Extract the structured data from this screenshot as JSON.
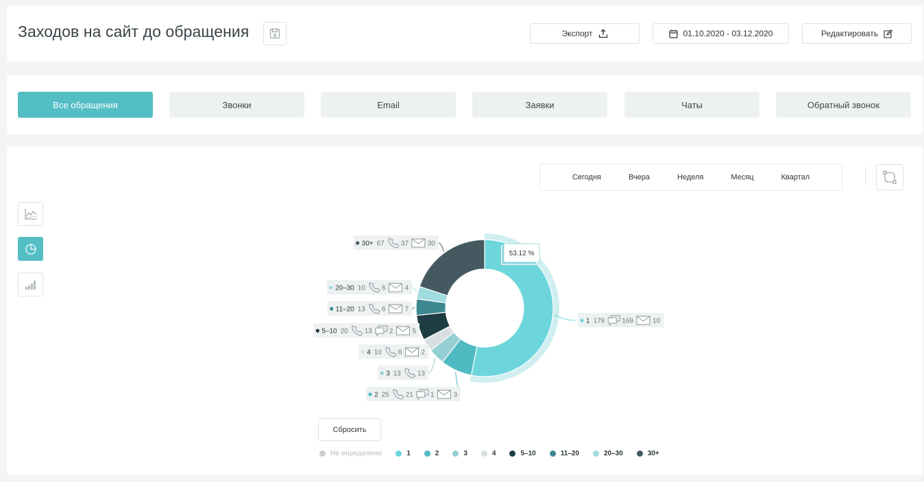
{
  "header": {
    "title": "Заходов на сайт до обращения",
    "export_label": "Экспорт",
    "date_range": "01.10.2020 - 03.12.2020",
    "edit_label": "Редактировать"
  },
  "tabs": [
    {
      "label": "Все обращения",
      "active": true
    },
    {
      "label": "Звонки",
      "active": false
    },
    {
      "label": "Email",
      "active": false
    },
    {
      "label": "Заявки",
      "active": false
    },
    {
      "label": "Чаты",
      "active": false
    },
    {
      "label": "Обратный звонок",
      "active": false
    }
  ],
  "periods": [
    "Сегодня",
    "Вчера",
    "Неделя",
    "Месяц",
    "Квартал"
  ],
  "side_icons": [
    "line-chart-icon",
    "pie-chart-icon",
    "bar-chart-icon"
  ],
  "reset_label": "Сбросить",
  "colors": {
    "accent": "#54bec5",
    "s1": "#6dd6dc",
    "s2": "#4fbac1",
    "s3": "#94cfd3",
    "s4": "#d9dfe0",
    "s5_10": "#1e3c44",
    "s11_20": "#3d8890",
    "s20_30": "#9fdce0",
    "s30plus": "#455a60",
    "undefined": "#c9cdce"
  },
  "chart_data": {
    "type": "pie",
    "tooltip": "53.12 %",
    "slices": [
      {
        "label": "1",
        "total": "179",
        "chats": "169",
        "emails": "10",
        "value": 179
      },
      {
        "label": "2",
        "total": "25",
        "calls": "21",
        "chats": "1",
        "emails": "3",
        "value": 25
      },
      {
        "label": "3",
        "total": "13",
        "calls": "13",
        "value": 13
      },
      {
        "label": "4",
        "total": "10",
        "calls": "8",
        "emails": "2",
        "value": 10
      },
      {
        "label": "5–10",
        "total": "20",
        "calls": "13",
        "chats": "2",
        "emails": "5",
        "value": 20
      },
      {
        "label": "11–20",
        "total": "13",
        "calls": "6",
        "emails": "7",
        "value": 13
      },
      {
        "label": "20–30",
        "total": "10",
        "calls": "6",
        "emails": "4",
        "value": 10
      },
      {
        "label": "30+",
        "total": "67",
        "calls": "37",
        "emails": "30",
        "value": 67
      }
    ],
    "legend": [
      {
        "label": "Не определено",
        "disabled": true
      },
      {
        "label": "1"
      },
      {
        "label": "2"
      },
      {
        "label": "3"
      },
      {
        "label": "4"
      },
      {
        "label": "5–10"
      },
      {
        "label": "11–20"
      },
      {
        "label": "20–30"
      },
      {
        "label": "30+"
      }
    ]
  }
}
